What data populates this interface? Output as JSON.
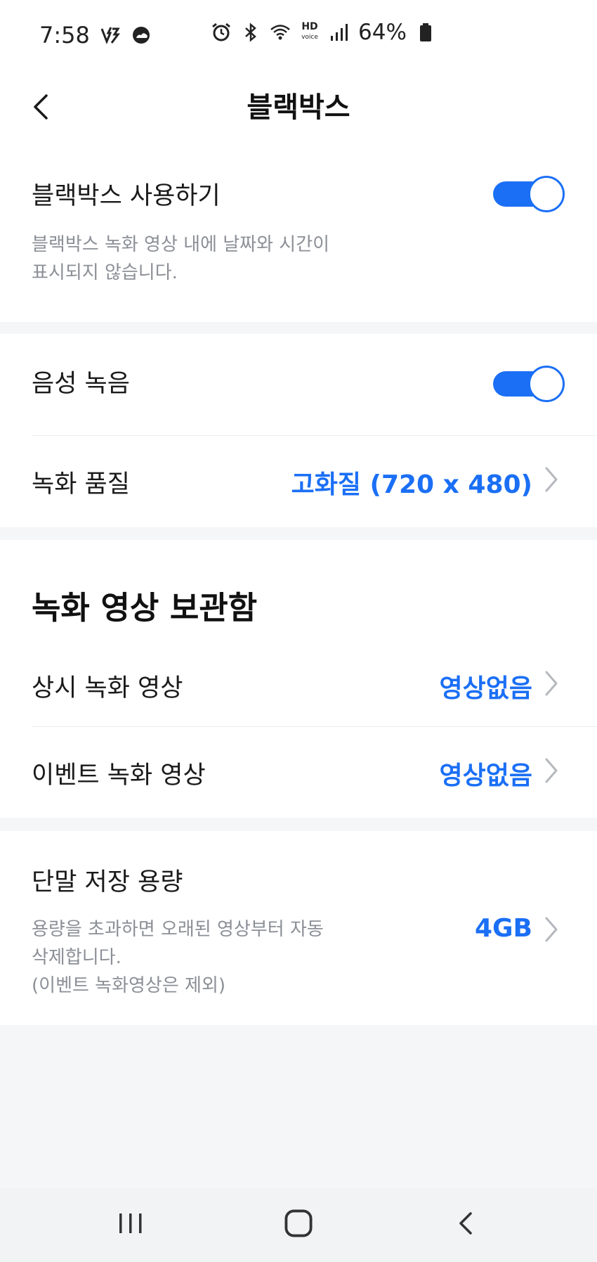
{
  "status_bar": {
    "time": "7:58",
    "battery_percent": "64%",
    "left_icons": [
      "voltage-icon",
      "weather-icon"
    ],
    "right_icons": [
      "alarm-icon",
      "bluetooth-icon",
      "wifi-icon",
      "hd-voice-icon",
      "signal-icon",
      "battery-icon"
    ],
    "hd_label": "HD",
    "voice_label": "voice"
  },
  "header": {
    "title": "블랙박스"
  },
  "blackbox": {
    "label": "블랙박스 사용하기",
    "enabled": true,
    "description_line1": "블랙박스 녹화 영상 내에 날짜와 시간이",
    "description_line2": "표시되지 않습니다."
  },
  "recording": {
    "audio_label": "음성 녹음",
    "audio_enabled": true,
    "quality_label": "녹화 품질",
    "quality_value": "고화질 (720 x 480)"
  },
  "storage_box": {
    "title": "녹화 영상 보관함",
    "continuous_label": "상시 녹화 영상",
    "continuous_value": "영상없음",
    "event_label": "이벤트 녹화 영상",
    "event_value": "영상없음"
  },
  "device_storage": {
    "label": "단말 저장 용량",
    "value": "4GB",
    "description_line1": "용량을 초과하면 오래된 영상부터 자동",
    "description_line2": "삭제합니다.",
    "description_line3": "(이벤트 녹화영상은 제외)"
  },
  "colors": {
    "accent": "#1b6ff5",
    "background": "#f5f6f8",
    "secondary_text": "#8b8f96"
  }
}
